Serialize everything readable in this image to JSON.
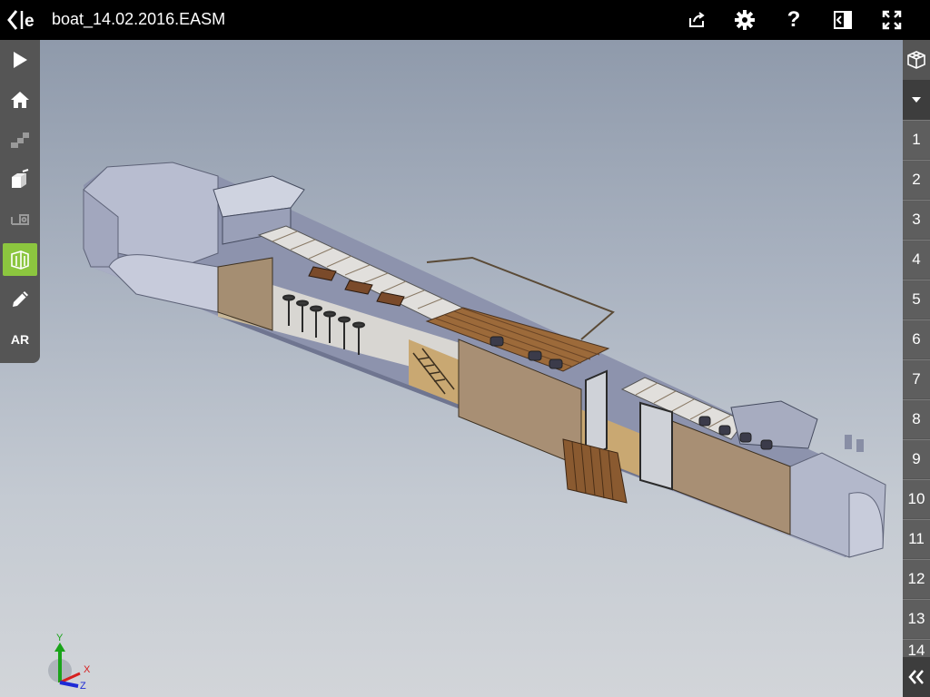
{
  "header": {
    "title": "boat_14.02.2016.EASM"
  },
  "toolbar": {
    "icons": [
      "back-icon",
      "share-icon",
      "gear-icon",
      "help-icon",
      "split-view-icon",
      "fullscreen-icon"
    ],
    "help_glyph": "?"
  },
  "left_toolbar": {
    "items": [
      "play-icon",
      "home-icon",
      "steps-icon",
      "explode-icon",
      "measure-icon",
      "section-icon",
      "pencil-icon"
    ],
    "ar_label": "AR",
    "active_color": "#8cc63f"
  },
  "right_panel": {
    "views_icon": "views-cube-icon",
    "dropdown_icon": "dropdown-arrow-icon",
    "steps": [
      "1",
      "2",
      "3",
      "4",
      "5",
      "6",
      "7",
      "8",
      "9",
      "10",
      "11",
      "12",
      "13",
      "14"
    ],
    "collapse_icon": "double-chevron-left-icon"
  },
  "triad": {
    "x": "X",
    "y": "Y",
    "z": "Z"
  },
  "colors": {
    "background": "#000000",
    "toolbar": "#555555",
    "accent": "#8cc63f"
  }
}
